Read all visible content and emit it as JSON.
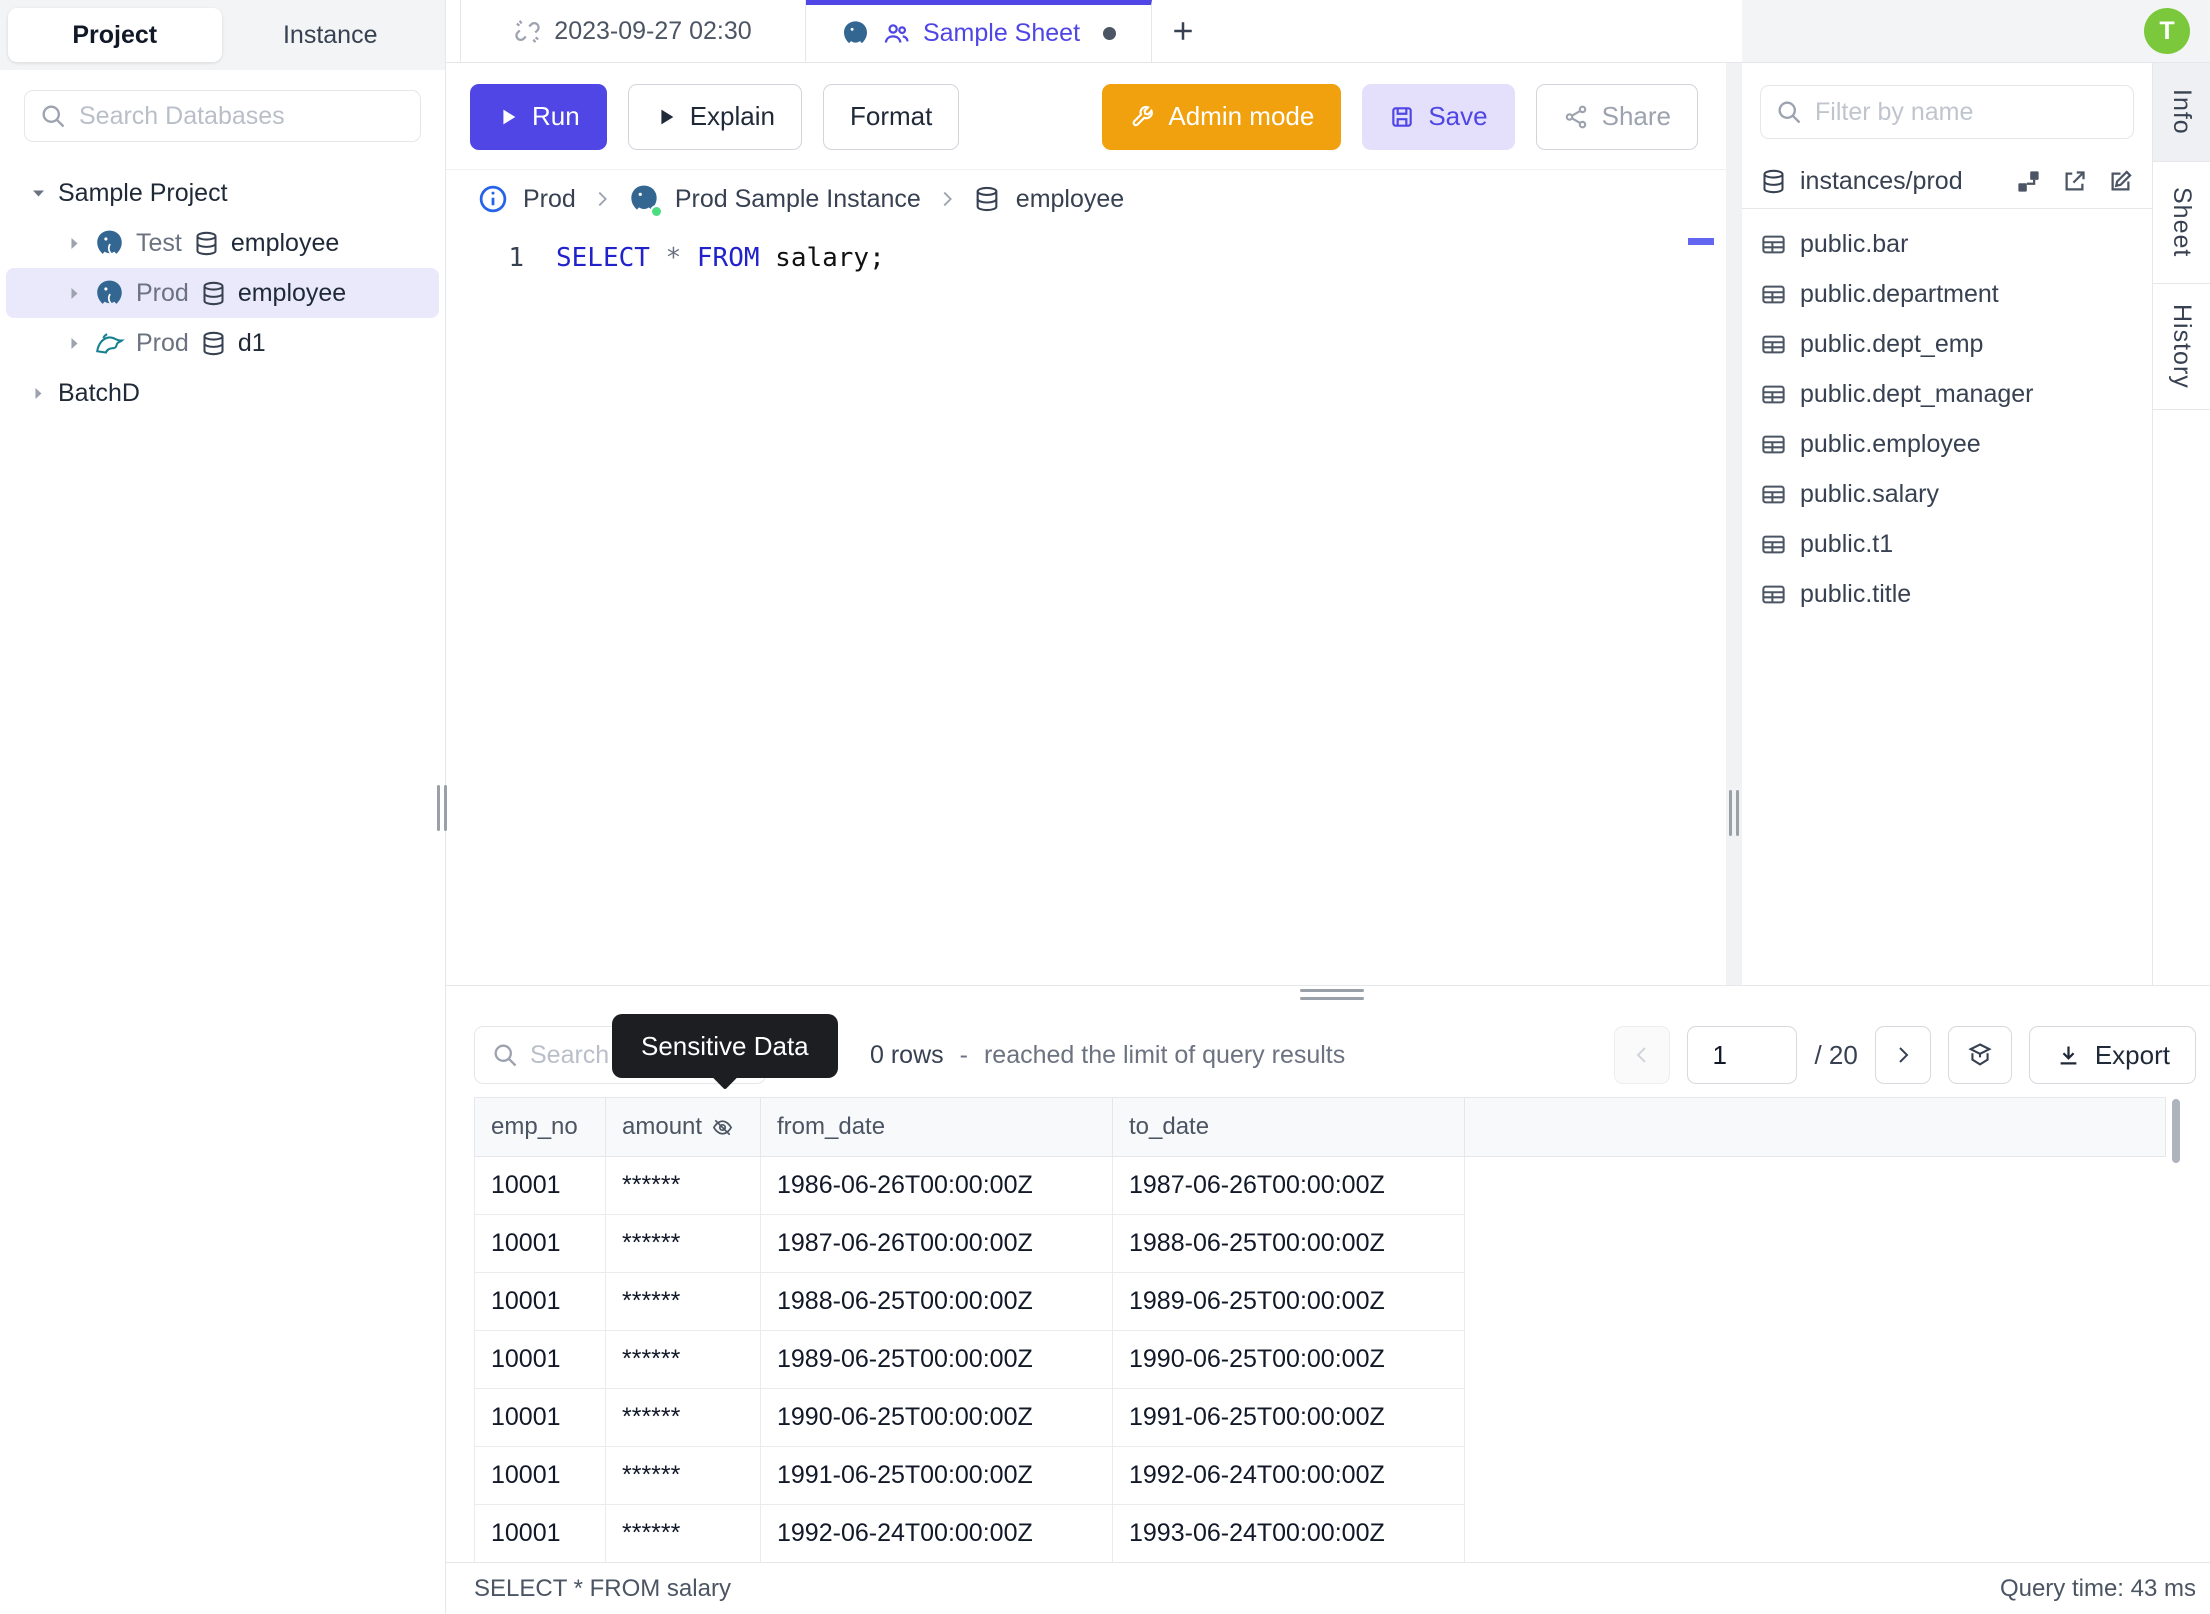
{
  "colors": {
    "accent_indigo": "#4f46e5",
    "admin_orange": "#f0a10d",
    "avatar_green": "#7cc83d",
    "keyword_blue": "#2222cc",
    "selected_row_bg": "#e9e9fb",
    "tooltip_bg": "#1c1e22"
  },
  "sidebar": {
    "tabs": {
      "project": "Project",
      "instance": "Instance"
    },
    "search_placeholder": "Search Databases",
    "tree": {
      "root": "Sample Project",
      "items": [
        {
          "engine": "postgres",
          "env": "Test",
          "db": "employee"
        },
        {
          "engine": "postgres",
          "env": "Prod",
          "db": "employee"
        },
        {
          "engine": "mysql",
          "env": "Prod",
          "db": "d1"
        }
      ],
      "batch": "BatchD"
    }
  },
  "tabbar": {
    "tab1_title": "2023-09-27 02:30",
    "tab2_title": "Sample Sheet",
    "avatar_initial": "T"
  },
  "toolbar": {
    "run": "Run",
    "explain": "Explain",
    "format": "Format",
    "admin_mode": "Admin mode",
    "save": "Save",
    "share": "Share"
  },
  "breadcrumb": {
    "environment": "Prod",
    "instance": "Prod Sample Instance",
    "database": "employee"
  },
  "editor": {
    "line_number": "1",
    "kw1": "SELECT",
    "star": " * ",
    "kw2": "FROM",
    "rest": " salary;"
  },
  "schema_panel": {
    "filter_placeholder": "Filter by name",
    "source": "instances/prod",
    "tables": [
      "public.bar",
      "public.department",
      "public.dept_emp",
      "public.dept_manager",
      "public.employee",
      "public.salary",
      "public.t1",
      "public.title"
    ]
  },
  "side_tabs": [
    "Info",
    "Sheet",
    "History"
  ],
  "results": {
    "search_placeholder": "Search",
    "tooltip": "Sensitive Data",
    "rows_count": "0 rows",
    "dash": "-",
    "limit_info": "reached the limit of query results",
    "page": "1",
    "page_total": "/ 20",
    "export_label": "Export",
    "columns": [
      "emp_no",
      "amount",
      "from_date",
      "to_date"
    ],
    "rows": [
      {
        "emp_no": "10001",
        "amount": "******",
        "from_date": "1986-06-26T00:00:00Z",
        "to_date": "1987-06-26T00:00:00Z"
      },
      {
        "emp_no": "10001",
        "amount": "******",
        "from_date": "1987-06-26T00:00:00Z",
        "to_date": "1988-06-25T00:00:00Z"
      },
      {
        "emp_no": "10001",
        "amount": "******",
        "from_date": "1988-06-25T00:00:00Z",
        "to_date": "1989-06-25T00:00:00Z"
      },
      {
        "emp_no": "10001",
        "amount": "******",
        "from_date": "1989-06-25T00:00:00Z",
        "to_date": "1990-06-25T00:00:00Z"
      },
      {
        "emp_no": "10001",
        "amount": "******",
        "from_date": "1990-06-25T00:00:00Z",
        "to_date": "1991-06-25T00:00:00Z"
      },
      {
        "emp_no": "10001",
        "amount": "******",
        "from_date": "1991-06-25T00:00:00Z",
        "to_date": "1992-06-24T00:00:00Z"
      },
      {
        "emp_no": "10001",
        "amount": "******",
        "from_date": "1992-06-24T00:00:00Z",
        "to_date": "1993-06-24T00:00:00Z"
      }
    ],
    "statement": "SELECT * FROM salary",
    "query_time": "Query time: 43 ms"
  }
}
